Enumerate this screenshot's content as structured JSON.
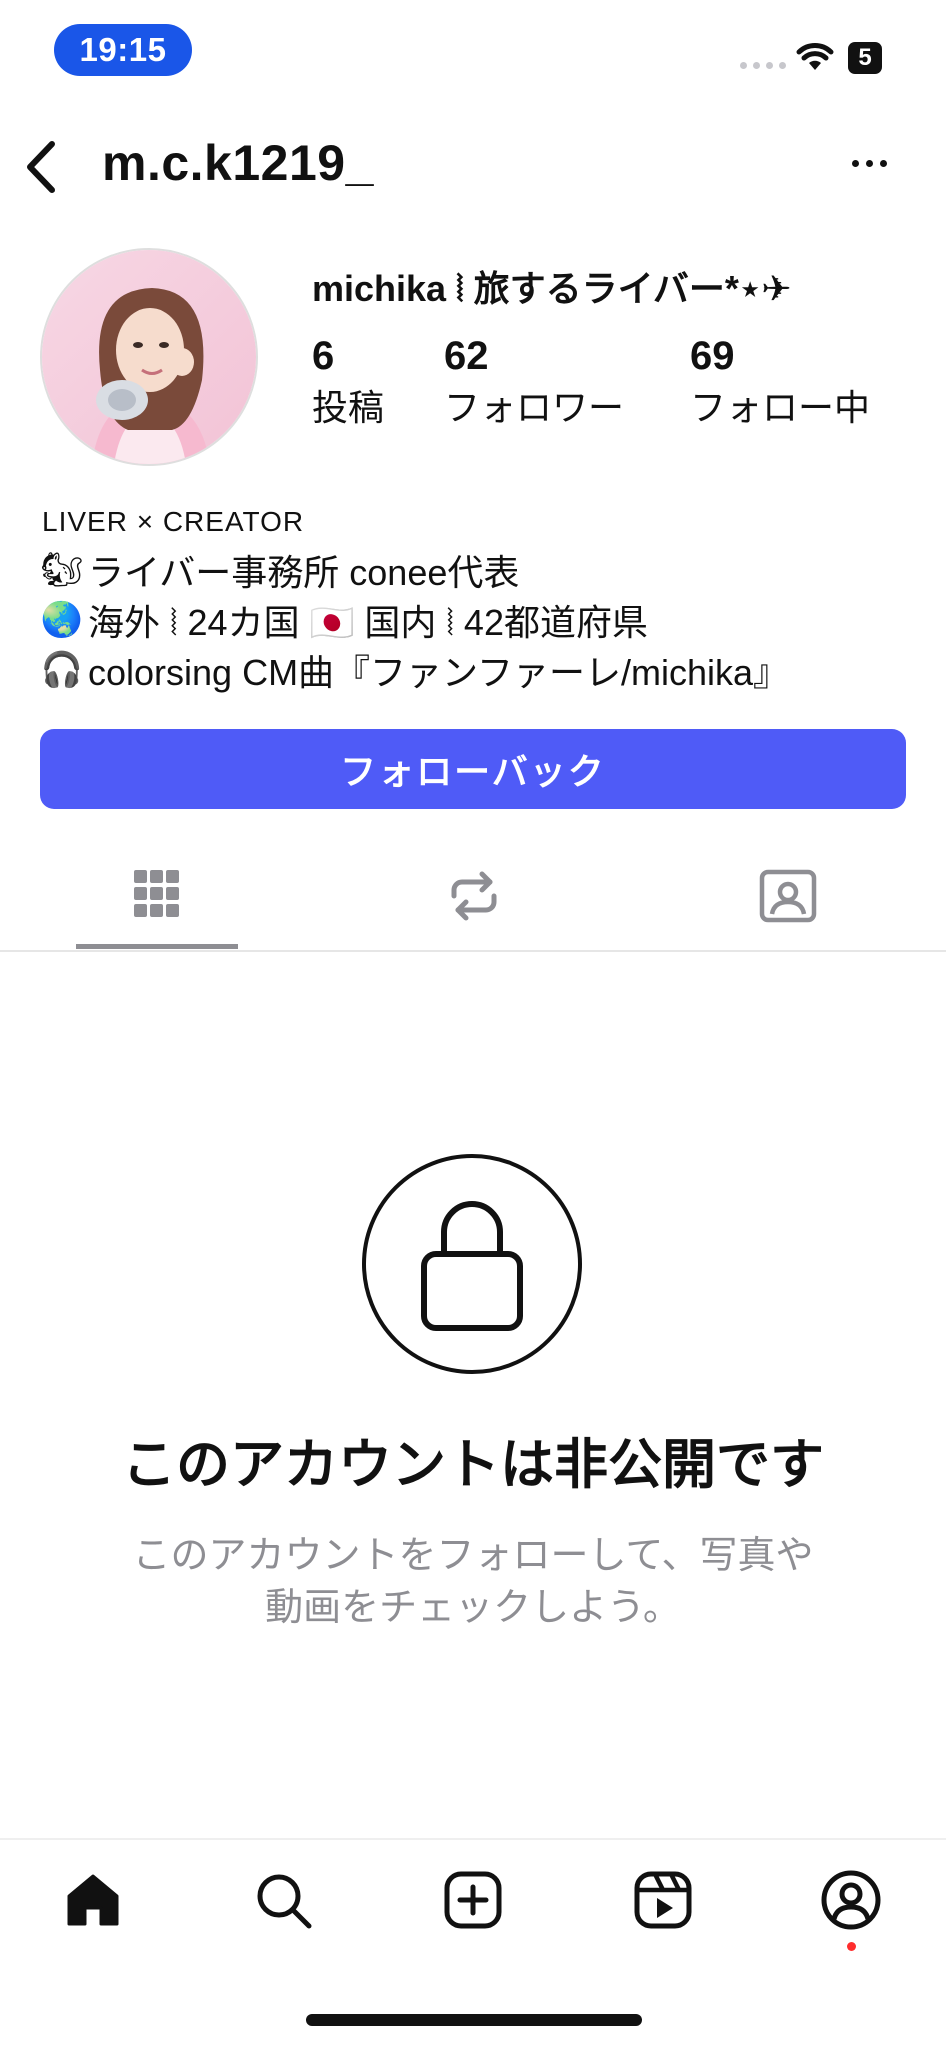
{
  "status_bar": {
    "time": "19:15",
    "battery": "5"
  },
  "header": {
    "username": "m.c.k1219_"
  },
  "profile": {
    "display_name": "michika ⦚ 旅するライバー*⋆✈",
    "stats": [
      {
        "value": "6",
        "label": "投稿"
      },
      {
        "value": "62",
        "label": "フォロワー"
      },
      {
        "value": "69",
        "label": "フォロー中"
      }
    ],
    "bio": {
      "tagline": "LIVER × CREATOR",
      "lines": [
        {
          "emoji": "🐿",
          "text": "ライバー事務所 conee代表"
        },
        {
          "emoji": "🌏",
          "text": "海外 ⦚ 24カ国 🇯🇵 国内 ⦚ 42都道府県"
        },
        {
          "emoji": "🎧",
          "text": "colorsing CM曲『ファンファーレ/michika』"
        }
      ]
    },
    "follow_button": "フォローバック"
  },
  "tabs": [
    "grid-icon",
    "reposts-icon",
    "tagged-icon"
  ],
  "private": {
    "title": "このアカウントは非公開です",
    "description_line1": "このアカウントをフォローして、写真や",
    "description_line2": "動画をチェックしよう。"
  },
  "bottom_nav": [
    "home-icon",
    "search-icon",
    "create-icon",
    "reels-icon",
    "profile-icon"
  ],
  "colors": {
    "follow_button": "#4f5bf7",
    "time_pill": "#1a56e8",
    "notification_dot": "#ff2d2d"
  }
}
